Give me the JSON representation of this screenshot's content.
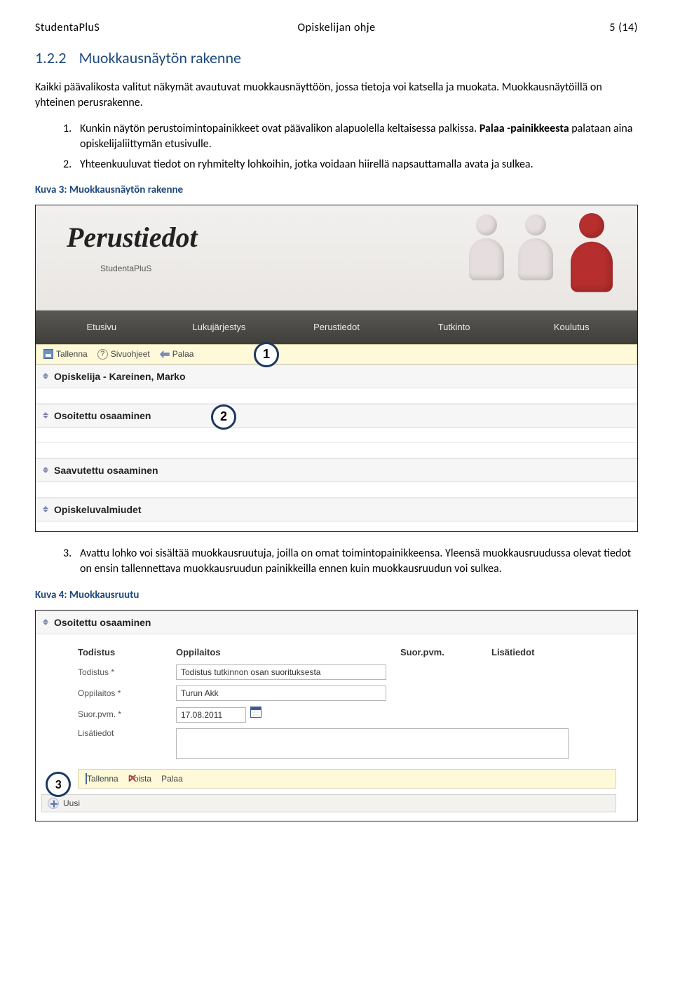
{
  "header": {
    "left": "StudentaPluS",
    "center": "Opiskelijan ohje",
    "right": "5 (14)"
  },
  "section": {
    "number": "1.2.2",
    "title": "Muokkausnäytön rakenne"
  },
  "para1": "Kaikki päävalikosta valitut näkymät avautuvat muokkausnäyttöön, jossa tietoja voi katsella ja muokata. Muokkausnäytöillä on yhteinen perusrakenne.",
  "list1": {
    "item1_a": "Kunkin näytön perustoimintopainikkeet ovat päävalikon alapuolella keltaisessa palkissa. ",
    "item1_b_bold": "Palaa -painikkeesta",
    "item1_c": " palataan aina opiskelijaliittymän etusivulle.",
    "item2": "Yhteenkuuluvat tiedot on ryhmitelty lohkoihin, jotka voidaan hiirellä napsauttamalla avata ja sulkea."
  },
  "caption1": "Kuva 3: Muokkausnäytön rakenne",
  "shot1": {
    "banner_title": "Perustiedot",
    "banner_sub": "StudentaPluS",
    "nav": [
      "Etusivu",
      "Lukujärjestys",
      "Perustiedot",
      "Tutkinto",
      "Koulutus"
    ],
    "toolbar": {
      "save": "Tallenna",
      "help": "Sivuohjeet",
      "back": "Palaa"
    },
    "sections": [
      "Opiskelija - Kareinen, Marko",
      "Osoitettu osaaminen",
      "Saavutettu osaaminen",
      "Opiskeluvalmiudet"
    ],
    "badge1": "1",
    "badge2": "2"
  },
  "list2": {
    "item3": "Avattu lohko voi sisältää muokkausruutuja, joilla on omat toimintopainikkeensa. Yleensä muokkausruudussa olevat tiedot on ensin tallennettava muokkausruudun painikkeilla ennen kuin muokkausruudun voi sulkea."
  },
  "caption2": "Kuva 4: Muokkausruutu",
  "shot2": {
    "section_title": "Osoitettu osaaminen",
    "cols": {
      "c1": "Todistus",
      "c2": "Oppilaitos",
      "c3": "Suor.pvm.",
      "c4": "Lisätiedot"
    },
    "rows": {
      "r1_label": "Todistus *",
      "r1_val": "Todistus tutkinnon osan suorituksesta",
      "r2_label": "Oppilaitos *",
      "r2_val": "Turun Akk",
      "r3_label": "Suor.pvm. *",
      "r3_val": "17.08.2011",
      "r4_label": "Lisätiedot"
    },
    "toolbar": {
      "save": "Tallenna",
      "del": "Poista",
      "back": "Palaa"
    },
    "uusi": "Uusi",
    "badge3": "3"
  }
}
